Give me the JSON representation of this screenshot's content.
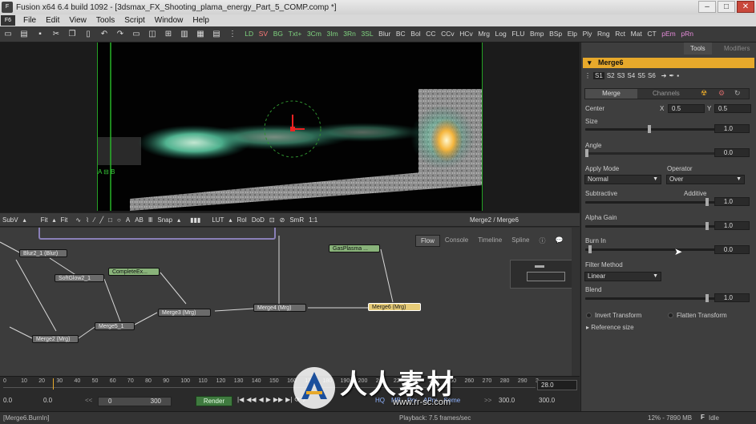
{
  "window": {
    "title": "Fusion x64 6.4 build 1092 - [3dsmax_FX_Shooting_plama_energy_Part_5_COMP.comp *]"
  },
  "menu": [
    "File",
    "Edit",
    "View",
    "Tools",
    "Script",
    "Window",
    "Help"
  ],
  "toolbar_tools": [
    {
      "label": "LD",
      "c": "g"
    },
    {
      "label": "SV",
      "c": "r"
    },
    {
      "label": "BG",
      "c": "g"
    },
    {
      "label": "Txt+",
      "c": "g"
    },
    {
      "label": "3Cm",
      "c": "g"
    },
    {
      "label": "3Im",
      "c": "g"
    },
    {
      "label": "3Rn",
      "c": "g"
    },
    {
      "label": "3SL",
      "c": "g"
    },
    {
      "label": "Blur",
      "c": ""
    },
    {
      "label": "BC",
      "c": ""
    },
    {
      "label": "Bol",
      "c": ""
    },
    {
      "label": "CC",
      "c": ""
    },
    {
      "label": "CCv",
      "c": ""
    },
    {
      "label": "HCv",
      "c": ""
    },
    {
      "label": "Mrg",
      "c": ""
    },
    {
      "label": "Log",
      "c": ""
    },
    {
      "label": "FLU",
      "c": ""
    },
    {
      "label": "Bmp",
      "c": ""
    },
    {
      "label": "BSp",
      "c": ""
    },
    {
      "label": "Elp",
      "c": ""
    },
    {
      "label": "Ply",
      "c": ""
    },
    {
      "label": "Rng",
      "c": ""
    },
    {
      "label": "Rct",
      "c": ""
    },
    {
      "label": "Mat",
      "c": ""
    },
    {
      "label": "CT",
      "c": ""
    },
    {
      "label": "pEm",
      "c": "p"
    },
    {
      "label": "pRn",
      "c": "p"
    }
  ],
  "viewer": {
    "ab_label": "A",
    "b_label": "B"
  },
  "viewer_toolbar": {
    "subv": "SubV",
    "fit1": "Fit",
    "fit2": "Fit",
    "snap": "Snap",
    "lut": "LUT",
    "roi": "RoI",
    "dod": "DoD",
    "smr": "SmR",
    "ratio": "1:1",
    "viewer_title": "Merge2 / Merge6"
  },
  "flow_tabs": [
    "Flow",
    "Console",
    "Timeline",
    "Spline"
  ],
  "nodes": [
    {
      "label": "Blur2_1 (Blur)",
      "style": "grey"
    },
    {
      "label": "SoftGlow2_1",
      "style": "grey"
    },
    {
      "label": "CompleteEx...",
      "style": "green"
    },
    {
      "label": "GasPlasma ...",
      "style": "green"
    },
    {
      "label": "Merge3 (Mrg)",
      "style": "grey"
    },
    {
      "label": "Merge4 (Mrg)",
      "style": "grey"
    },
    {
      "label": "Merge6 (Mrg)",
      "style": "yellow"
    },
    {
      "label": "Merge5_1",
      "style": "grey"
    },
    {
      "label": "Merge2 (Mrg)",
      "style": "grey"
    }
  ],
  "timeline": {
    "ruler": [
      "0",
      "10",
      "20",
      "30",
      "40",
      "50",
      "60",
      "70",
      "80",
      "90",
      "100",
      "110",
      "120",
      "130",
      "140",
      "150",
      "160",
      "170",
      "180",
      "190",
      "200",
      "210",
      "220",
      "230",
      "240",
      "250",
      "260",
      "270",
      "280",
      "290",
      "3"
    ],
    "current_frame": "28.0",
    "global_start": "0.0",
    "render_start": "0.0",
    "range_start": "0",
    "range_end": "300",
    "render_label": "Render",
    "hq": "HQ",
    "mb": "MB",
    "prx": "Prx",
    "aprx": "APrx",
    "some": "Some",
    "render_end": "300.0",
    "global_end": "300.0",
    "nav": ">>"
  },
  "status": {
    "left": "[Merge6.BurnIn]",
    "playback": "Playback: 7.5 frames/sec",
    "memory": "12% - 7890 MB",
    "state": "Idle"
  },
  "panel": {
    "tab_tools": "Tools",
    "tab_modifiers": "Modifiers",
    "tool_name": "Merge6",
    "slots": [
      "S1",
      "S2",
      "S3",
      "S4",
      "S5",
      "S6"
    ],
    "subtabs": [
      "Merge",
      "Channels"
    ],
    "center_label": "Center",
    "x_label": "X",
    "x_val": "0.5",
    "y_label": "Y",
    "y_val": "0.5",
    "size_label": "Size",
    "size_val": "1.0",
    "angle_label": "Angle",
    "angle_val": "0.0",
    "apply_mode_label": "Apply Mode",
    "apply_mode_val": "Normal",
    "operator_label": "Operator",
    "operator_val": "Over",
    "subtractive_label": "Subtractive",
    "additive_label": "Additive",
    "additive_val": "1.0",
    "alpha_gain_label": "Alpha Gain",
    "alpha_gain_val": "1.0",
    "burn_in_label": "Burn In",
    "burn_in_val": "0.0",
    "filter_label": "Filter Method",
    "filter_val": "Linear",
    "blend_label": "Blend",
    "blend_val": "1.0",
    "invert": "Invert Transform",
    "flatten": "Flatten Transform",
    "reference": "Reference size"
  },
  "watermark": {
    "text": "人人素材",
    "url": "www.rr-sc.com"
  },
  "colors": {
    "accent": "#e7a92b",
    "node_selected": "#e7cc78",
    "loader_node": "#89b37a"
  }
}
